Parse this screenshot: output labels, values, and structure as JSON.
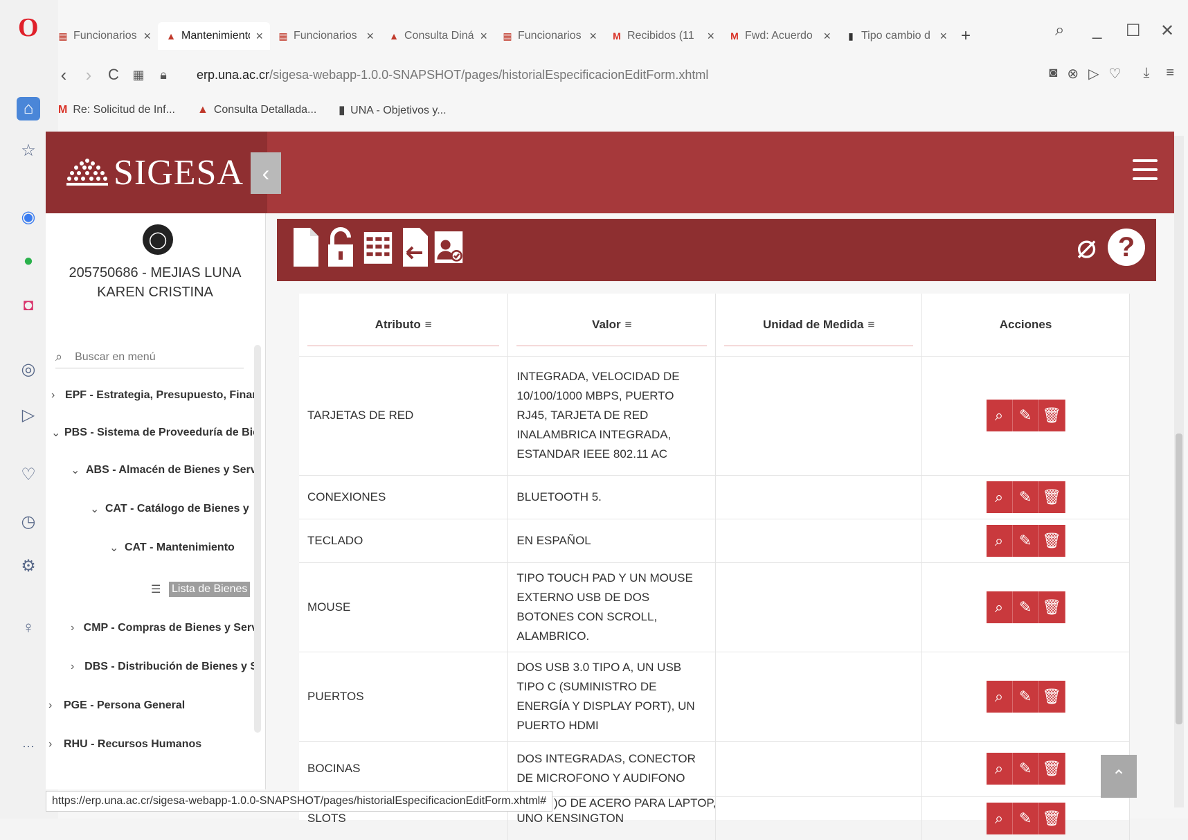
{
  "browser": {
    "tabs": [
      {
        "title": "Funcionarios |",
        "icon": "una-icon",
        "active": false
      },
      {
        "title": "Mantenimiento",
        "icon": "doc-red-icon",
        "active": true
      },
      {
        "title": "Funcionarios |",
        "icon": "una-icon",
        "active": false
      },
      {
        "title": "Consulta Dinár",
        "icon": "doc-red-icon",
        "active": false
      },
      {
        "title": "Funcionarios |",
        "icon": "una-icon",
        "active": false
      },
      {
        "title": "Recibidos (11",
        "icon": "gmail-icon",
        "active": false
      },
      {
        "title": "Fwd: Acuerdo",
        "icon": "gmail-icon",
        "active": false
      },
      {
        "title": "Tipo cambio d",
        "icon": "doc-icon",
        "active": false
      }
    ],
    "url_host": "erp.una.ac.cr",
    "url_path": "/sigesa-webapp-1.0.0-SNAPSHOT/pages/historialEspecificacionEditForm.xhtml",
    "bookmarks": [
      {
        "label": "Re: Solicitud de Inf...",
        "icon": "gmail-icon"
      },
      {
        "label": "Consulta Detallada...",
        "icon": "doc-red-icon"
      },
      {
        "label": "UNA - Objetivos y...",
        "icon": "doc-icon"
      }
    ],
    "status_url": "https://erp.una.ac.cr/sigesa-webapp-1.0.0-SNAPSHOT/pages/historialEspecificacionEditForm.xhtml#"
  },
  "app": {
    "brand": "SIGESA",
    "user": "205750686 - MEJIAS LUNA KAREN CRISTINA",
    "search_placeholder": "Buscar en menú",
    "menu": [
      {
        "label": "EPF - Estrategia, Presupuesto, Finan",
        "chevron": "›",
        "level": 0
      },
      {
        "label": "PBS - Sistema de Proveeduría de Bie",
        "chevron": "⌄",
        "level": 0
      },
      {
        "label": "ABS - Almacén de Bienes y Serv",
        "chevron": "⌄",
        "level": 1
      },
      {
        "label": "CAT - Catálogo de Bienes y",
        "chevron": "⌄",
        "level": 2
      },
      {
        "label": "CAT - Mantenimiento",
        "chevron": "⌄",
        "level": 3
      },
      {
        "label": "Lista de Bienes",
        "chevron": "☰",
        "level": 4
      },
      {
        "label": "CMP - Compras de Bienes y Serv",
        "chevron": "›",
        "level": 1
      },
      {
        "label": "DBS - Distribución de Bienes y S",
        "chevron": "›",
        "level": 1
      },
      {
        "label": "PGE - Persona General",
        "chevron": "›",
        "level": 0
      },
      {
        "label": "RHU - Recursos Humanos",
        "chevron": "›",
        "level": 0
      }
    ]
  },
  "table": {
    "headers": [
      "Atributo",
      "Valor",
      "Unidad de Medida",
      "Acciones"
    ],
    "rows": [
      {
        "atributo": "TARJETAS DE RED",
        "valor": "INTEGRADA, VELOCIDAD DE 10/100/1000 MBPS, PUERTO RJ45, TARJETA DE RED INALAMBRICA INTEGRADA, ESTANDAR IEEE 802.11 AC",
        "unidad": ""
      },
      {
        "atributo": "CONEXIONES",
        "valor": "BLUETOOTH 5.",
        "unidad": ""
      },
      {
        "atributo": "TECLADO",
        "valor": "EN ESPAÑOL",
        "unidad": ""
      },
      {
        "atributo": "MOUSE",
        "valor": "TIPO TOUCH PAD Y UN MOUSE EXTERNO USB DE DOS BOTONES CON SCROLL, ALAMBRICO.",
        "unidad": ""
      },
      {
        "atributo": "PUERTOS",
        "valor": "DOS USB 3.0 TIPO A, UN USB TIPO C (SUMINISTRO DE ENERGÍA Y DISPLAY PORT), UN PUERTO HDMI",
        "unidad": ""
      },
      {
        "atributo": "BOCINAS",
        "valor": "DOS INTEGRADAS, CONECTOR DE MICROFONO Y AUDIFONO",
        "unidad": ""
      },
      {
        "atributo": "SLOTS",
        "valor": "UNO KENSINGTON",
        "unidad": ""
      }
    ],
    "partial_row_text": ")O DE ACERO PARA LAPTOP,"
  },
  "colors": {
    "brand": "#a6393b",
    "brand_dark": "#8e2f30",
    "action": "#c9393d"
  }
}
